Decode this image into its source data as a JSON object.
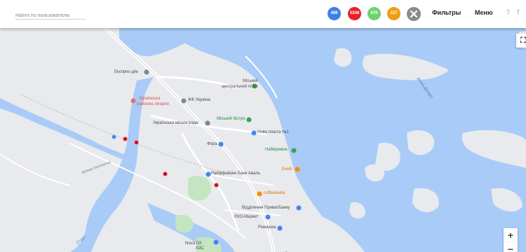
{
  "header": {
    "search_placeholder": "Найти по пользователю",
    "counters": [
      {
        "value": "489",
        "color": "#3d7fe6"
      },
      {
        "value": "5348",
        "color": "#e8202a"
      },
      {
        "value": "679",
        "color": "#6fd26a"
      },
      {
        "value": "327",
        "color": "#f39c12"
      }
    ],
    "filters_label": "Фильтры",
    "menu_label": "Меню",
    "help_glyph": "?",
    "social_glyph": "f"
  },
  "map": {
    "labels": {
      "expres_dim": "Експрес-дім",
      "hospital_line1": "Українська",
      "hospital_line2": "районна лікарня",
      "zhk": "ЖК Україна",
      "city_beach_line1": "Міський",
      "city_beach_line2": "центральний пляж",
      "city_council": "Українська міська рада",
      "city_bistro": "Міський бістро",
      "nova_poshta": "Нова пошта №2",
      "fora": "Фора",
      "naberezhna": "Набережна",
      "raiffeisen": "Райффайзен Банк Аваль",
      "enei": "Еней",
      "coffeelavka": "coffeelavka",
      "privatbank": "Відділення ПриватБанку",
      "eko_market": "ЕКО-Маркет",
      "romashka": "Ромашка",
      "nova_oil_line1": "Nova Oil",
      "nova_oil_line2": "АЗС",
      "river": "річка Дніпро",
      "road_small": "вулиця Залізнична",
      "strug": "Струг"
    },
    "zoom_in": "+",
    "zoom_out": "−",
    "fullscreen_glyph": "⛶",
    "marker_colors": {
      "blue": "#3d7fe6",
      "red": "#d0021b"
    }
  }
}
